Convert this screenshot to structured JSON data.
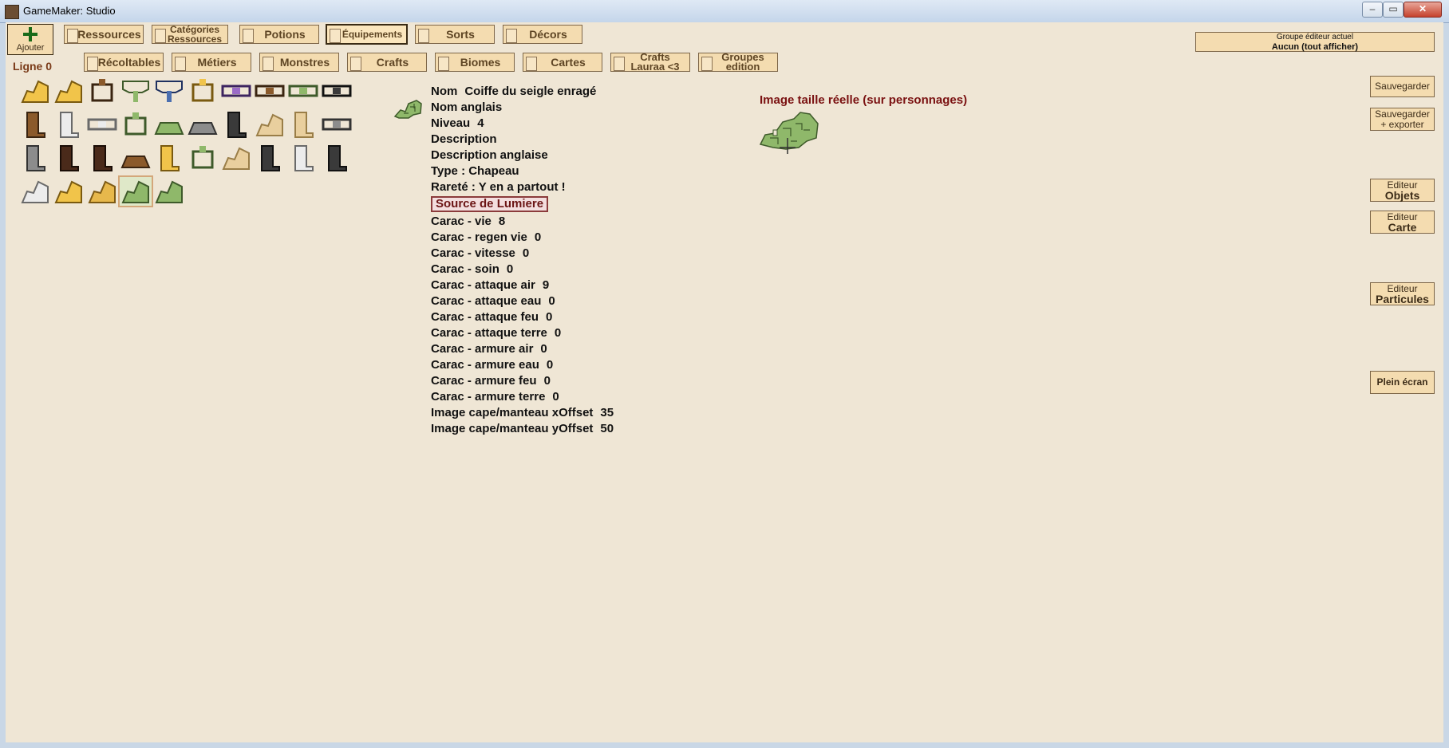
{
  "window": {
    "title": "GameMaker: Studio"
  },
  "toolbar": {
    "add_label": "Ajouter",
    "row1": [
      {
        "label": "Ressources"
      },
      {
        "label": "Catégories",
        "label2": "Ressources"
      },
      {
        "label": "Potions"
      },
      {
        "label": "Équipements",
        "selected": true
      },
      {
        "label": "Sorts"
      },
      {
        "label": "Décors"
      }
    ],
    "row2": [
      {
        "label": "Récoltables"
      },
      {
        "label": "Métiers"
      },
      {
        "label": "Monstres"
      },
      {
        "label": "Crafts"
      },
      {
        "label": "Biomes"
      },
      {
        "label": "Cartes"
      },
      {
        "label": "Crafts",
        "label2": "Lauraa <3"
      },
      {
        "label": "Groupes",
        "label2": "edition"
      }
    ],
    "ligne": "Ligne 0",
    "group_title": "Groupe éditeur actuel",
    "group_value": "Aucun (tout afficher)"
  },
  "sidebar": {
    "save": "Sauvegarder",
    "save_export_1": "Sauvegarder",
    "save_export_2": "+ exporter",
    "editor_objects_1": "Editeur",
    "editor_objects_2": "Objets",
    "editor_map_1": "Editeur",
    "editor_map_2": "Carte",
    "editor_particles_1": "Editeur",
    "editor_particles_2": "Particules",
    "fullscreen": "Plein écran"
  },
  "icons": [
    "hat-yellow-icon",
    "cape-yellow-icon",
    "amulet-brown-icon",
    "tree-green-icon",
    "tree-blue-icon",
    "crown-yellow-icon",
    "belt-purple-icon",
    "belt-brown-icon",
    "necklace-green-icon",
    "belt-black-icon",
    "boots-brown-icon",
    "boots-white-icon",
    "belt-white-icon",
    "amulet-green-icon",
    "shield-green-icon",
    "armor-grey-icon",
    "staff-black-icon",
    "wing-beige-icon",
    "staff-beige-icon",
    "belt-grey-icon",
    "boots-grey-icon",
    "boots-dark-icon",
    "staff-darkbrown-icon",
    "armor-brown-icon",
    "staff-yellow-icon",
    "crown-green-icon",
    "cape-beige-icon",
    "boots-black-icon",
    "boots-white2-icon",
    "boots-black2-icon",
    "cape-white-icon",
    "wing-yellow-icon",
    "cape-gold-icon",
    "cap-green-selected-icon",
    "cape-green-icon"
  ],
  "item": {
    "name_label": "Nom",
    "name_value": "Coiffe du seigle enragé",
    "name_en_label": "Nom anglais",
    "name_en_value": "",
    "level_label": "Niveau",
    "level_value": "4",
    "desc_label": "Description",
    "desc_value": "",
    "desc_en_label": "Description anglaise",
    "desc_en_value": "",
    "type": "Type : Chapeau",
    "rarity": "Rareté : Y en a partout !",
    "light_source": "Source de Lumiere",
    "stats": [
      {
        "label": "Carac - vie",
        "value": "8"
      },
      {
        "label": "Carac - regen vie",
        "value": "0"
      },
      {
        "label": "Carac - vitesse",
        "value": "0"
      },
      {
        "label": "Carac - soin",
        "value": "0"
      },
      {
        "label": "Carac - attaque air",
        "value": "9"
      },
      {
        "label": "Carac - attaque eau",
        "value": "0"
      },
      {
        "label": "Carac - attaque feu",
        "value": "0"
      },
      {
        "label": "Carac - attaque terre",
        "value": "0"
      },
      {
        "label": "Carac - armure air",
        "value": "0"
      },
      {
        "label": "Carac - armure eau",
        "value": "0"
      },
      {
        "label": "Carac - armure feu",
        "value": "0"
      },
      {
        "label": "Carac - armure terre",
        "value": "0"
      },
      {
        "label": "Image cape/manteau xOffset",
        "value": "35"
      },
      {
        "label": "Image cape/manteau yOffset",
        "value": "50"
      }
    ]
  },
  "preview": {
    "title": "Image taille réelle (sur personnages)"
  },
  "colors": {
    "background": "#efe6d5",
    "button": "#f4dcb0",
    "button_text": "#5e4524",
    "accent_red": "#7a1111"
  }
}
